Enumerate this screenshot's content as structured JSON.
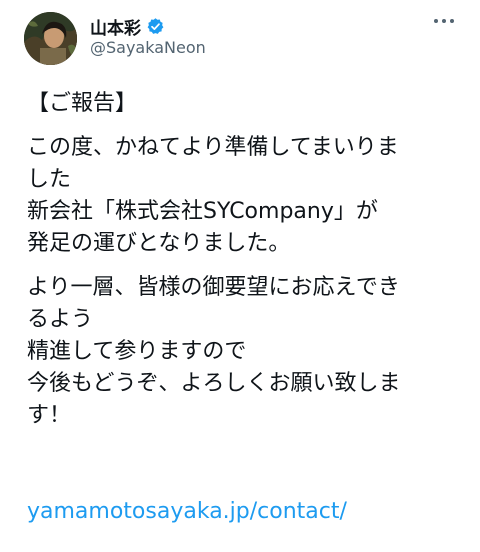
{
  "author": {
    "display_name": "山本彩",
    "handle": "@SayakaNeon",
    "verified": true
  },
  "tweet": {
    "paragraphs": [
      [
        "【ご報告】"
      ],
      [
        "この度、かねてより準備してまいりま",
        "した",
        "新会社「株式会社SYCompany」が",
        "発足の運びとなりました。"
      ],
      [
        "より一層、皆様の御要望にお応えでき",
        "るよう",
        "精進して参りますので",
        "今後もどうぞ、よろしくお願い致しま",
        "す！"
      ]
    ],
    "link": "yamamotosayaka.jp/contact/"
  },
  "colors": {
    "text": "#0f1419",
    "secondary": "#536471",
    "link": "#1d9bf0",
    "verified": "#1d9bf0"
  },
  "icons": {
    "verified": "verified-badge-icon",
    "more": "more-options-icon"
  }
}
